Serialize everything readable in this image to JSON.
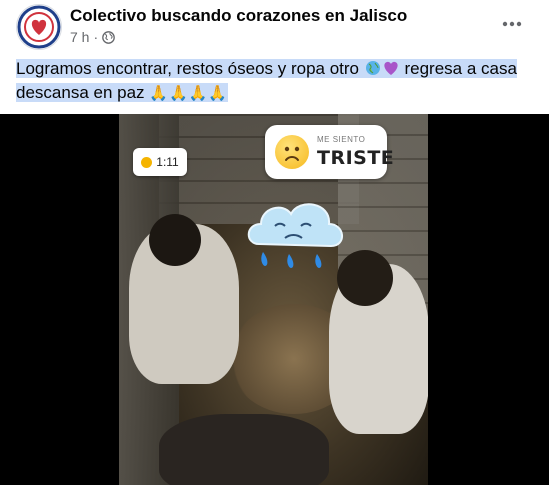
{
  "post": {
    "page_name": "Colectivo buscando corazones en Jalisco",
    "time": "7 h",
    "separator": "·",
    "privacy_icon": "globe-icon",
    "more_icon": "more-options-icon",
    "text_line1": "Logramos encontrar, restos óseos y ropa otro",
    "text_line1_end": "regresa a casa",
    "text_line2": "descansa en paz",
    "emojis_inline": [
      "globe-emoji",
      "purple-heart-emoji"
    ],
    "emojis_end": "🙏🙏🙏🙏"
  },
  "media": {
    "timer_label": "1:11",
    "sticker_small": "ME SIENTO",
    "sticker_big": "TRISTE",
    "sticker_icon": "sad-face-icon",
    "cloud_icon": "crying-cloud-icon"
  },
  "colors": {
    "highlight": "#c8dbf8",
    "text": "#050505",
    "secondary": "#65676b"
  }
}
